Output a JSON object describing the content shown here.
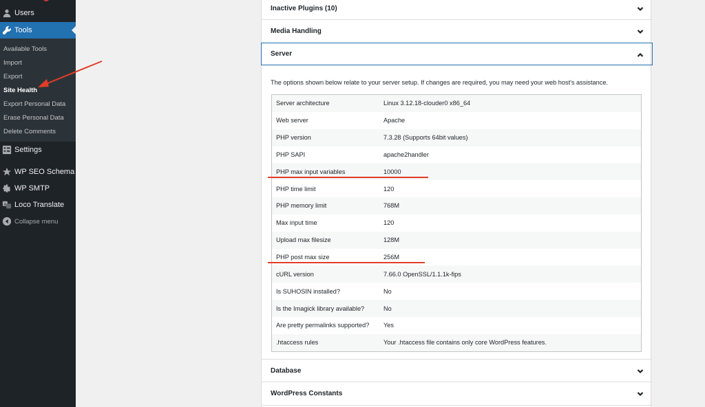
{
  "sidebar": {
    "menu": [
      {
        "label": "Users",
        "icon": "users-icon"
      },
      {
        "label": "Tools",
        "icon": "wrench-icon"
      },
      {
        "label": "Settings",
        "icon": "settings-icon"
      },
      {
        "label": "WP SEO Schema",
        "icon": "schema-icon"
      },
      {
        "label": "WP SMTP",
        "icon": "gear-icon"
      },
      {
        "label": "Loco Translate",
        "icon": "translate-icon"
      }
    ],
    "tools_submenu": [
      {
        "label": "Available Tools"
      },
      {
        "label": "Import"
      },
      {
        "label": "Export"
      },
      {
        "label": "Site Health"
      },
      {
        "label": "Export Personal Data"
      },
      {
        "label": "Erase Personal Data"
      },
      {
        "label": "Delete Comments"
      }
    ],
    "collapse_label": "Collapse menu"
  },
  "sections": {
    "inactive_plugins": "Inactive Plugins (10)",
    "media_handling": "Media Handling",
    "server": "Server",
    "database": "Database",
    "wp_constants": "WordPress Constants"
  },
  "server": {
    "description": "The options shown below relate to your server setup. If changes are required, you may need your web host's assistance.",
    "rows": [
      {
        "key": "Server architecture",
        "value": "Linux 3.12.18-clouder0 x86_64"
      },
      {
        "key": "Web server",
        "value": "Apache"
      },
      {
        "key": "PHP version",
        "value": "7.3.28 (Supports 64bit values)"
      },
      {
        "key": "PHP SAPI",
        "value": "apache2handler"
      },
      {
        "key": "PHP max input variables",
        "value": "10000"
      },
      {
        "key": "PHP time limit",
        "value": "120"
      },
      {
        "key": "PHP memory limit",
        "value": "768M"
      },
      {
        "key": "Max input time",
        "value": "120"
      },
      {
        "key": "Upload max filesize",
        "value": "128M"
      },
      {
        "key": "PHP post max size",
        "value": "256M"
      },
      {
        "key": "cURL version",
        "value": "7.66.0 OpenSSL/1.1.1k-fips"
      },
      {
        "key": "Is SUHOSIN installed?",
        "value": "No"
      },
      {
        "key": "Is the Imagick library available?",
        "value": "No"
      },
      {
        "key": "Are pretty permalinks supported?",
        "value": "Yes"
      },
      {
        "key": ".htaccess rules",
        "value": "Your .htaccess file contains only core WordPress features."
      }
    ]
  },
  "colors": {
    "sidebar_bg": "#1d2327",
    "accent": "#2271b1",
    "annotation": "#e23d28"
  }
}
